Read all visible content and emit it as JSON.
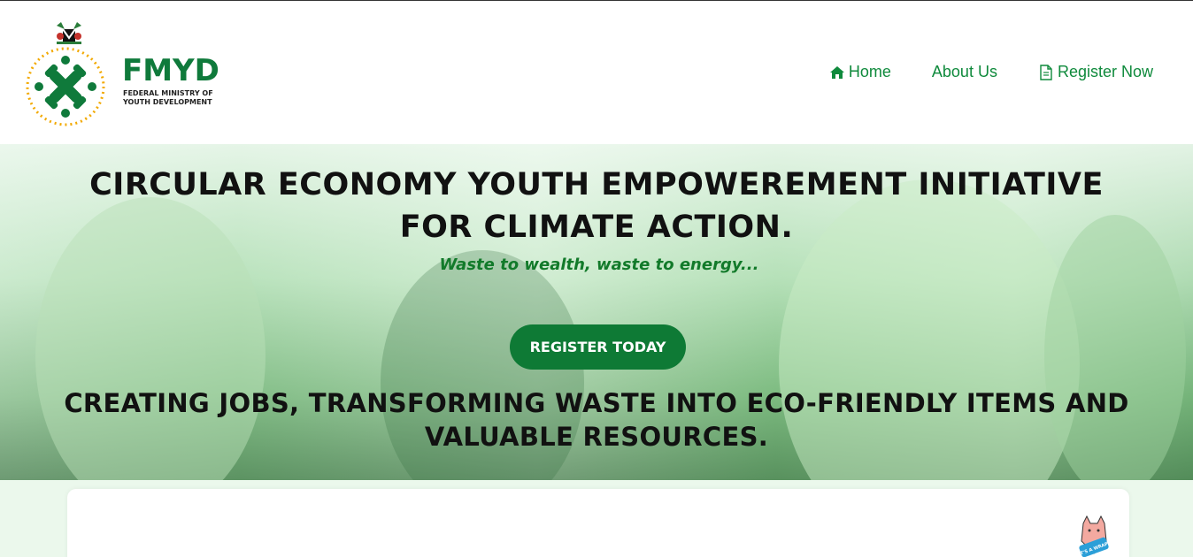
{
  "header": {
    "logo": {
      "title": "FMYD",
      "subtitle_line1": "FEDERAL MINISTRY OF",
      "subtitle_line2": "YOUTH DEVELOPMENT"
    },
    "nav": [
      {
        "label": "Home",
        "icon": "home-icon"
      },
      {
        "label": "About Us"
      },
      {
        "label": "Register Now",
        "icon": "document-icon"
      }
    ]
  },
  "hero": {
    "title_line1": "CIRCULAR ECONOMY YOUTH EMPOWEREMENT INITIATIVE",
    "title_line2": "FOR CLIMATE ACTION.",
    "tagline": "Waste to wealth, waste to energy...",
    "cta_label": "REGISTER TODAY",
    "subtitle_line1": "CREATING JOBS, TRANSFORMING WASTE INTO ECO-FRIENDLY ITEMS AND",
    "subtitle_line2": "VALUABLE RESOURCES."
  },
  "sticker": {
    "text": "IT'S A WRAP!"
  },
  "colors": {
    "brand_green": "#0f7a3b",
    "nav_green": "#0f8a3c",
    "cta_green": "#0e7a35",
    "tagline_green": "#127a2a",
    "lower_bg": "#ebf8ec"
  }
}
